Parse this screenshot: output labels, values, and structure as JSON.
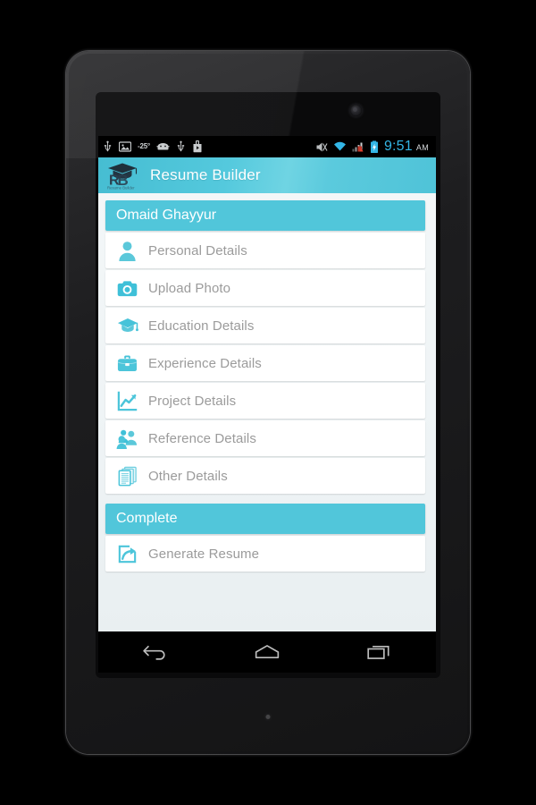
{
  "device": {
    "type": "android-tablet",
    "camera_icon": "front-camera",
    "led_icon": "notification-led"
  },
  "statusbar": {
    "left_icons": [
      {
        "name": "usb-icon",
        "glyph": "usb"
      },
      {
        "name": "image-icon",
        "glyph": "picture"
      },
      {
        "name": "temperature-indicator",
        "label": "-25°"
      },
      {
        "name": "android-debug-icon",
        "glyph": "android-head"
      },
      {
        "name": "usb-debug-icon",
        "glyph": "usb"
      },
      {
        "name": "play-store-icon",
        "glyph": "play-bag"
      }
    ],
    "right_icons": [
      {
        "name": "mute-icon",
        "glyph": "speaker-muted"
      },
      {
        "name": "wifi-icon",
        "glyph": "wifi-full"
      },
      {
        "name": "cellular-signal-icon",
        "glyph": "signal-bars"
      },
      {
        "name": "battery-charging-icon",
        "glyph": "battery-bolt"
      }
    ],
    "clock": "9:51",
    "meridiem": "AM",
    "clock_color": "#33b5e5"
  },
  "actionbar": {
    "logo_name": "resume-builder-logo",
    "logo_initials": "RB",
    "logo_caption": "Resume Builder",
    "title": "Resume Builder",
    "background_color": "#54c9dd"
  },
  "content": {
    "sections": [
      {
        "header": "Omaid Ghayyur",
        "header_name": "user-name-section-header",
        "items": [
          {
            "label": "Personal Details",
            "icon": "person-icon",
            "name": "personal-details"
          },
          {
            "label": "Upload Photo",
            "icon": "camera-icon",
            "name": "upload-photo"
          },
          {
            "label": "Education Details",
            "icon": "graduation-cap-icon",
            "name": "education-details"
          },
          {
            "label": "Experience Details",
            "icon": "briefcase-icon",
            "name": "experience-details"
          },
          {
            "label": "Project Details",
            "icon": "chart-line-icon",
            "name": "project-details"
          },
          {
            "label": "Reference Details",
            "icon": "people-group-icon",
            "name": "reference-details"
          },
          {
            "label": "Other Details",
            "icon": "documents-stack-icon",
            "name": "other-details"
          }
        ]
      },
      {
        "header": "Complete",
        "header_name": "complete-section-header",
        "items": [
          {
            "label": "Generate Resume",
            "icon": "export-arrow-icon",
            "name": "generate-resume"
          }
        ]
      }
    ],
    "accent_color": "#51c6da",
    "label_color": "#9b9b9b",
    "background_color": "#eef3f5"
  },
  "navbar": {
    "buttons": [
      {
        "name": "back-button",
        "icon": "back-arrow-icon"
      },
      {
        "name": "home-button",
        "icon": "home-icon"
      },
      {
        "name": "recents-button",
        "icon": "recent-apps-icon"
      }
    ]
  }
}
